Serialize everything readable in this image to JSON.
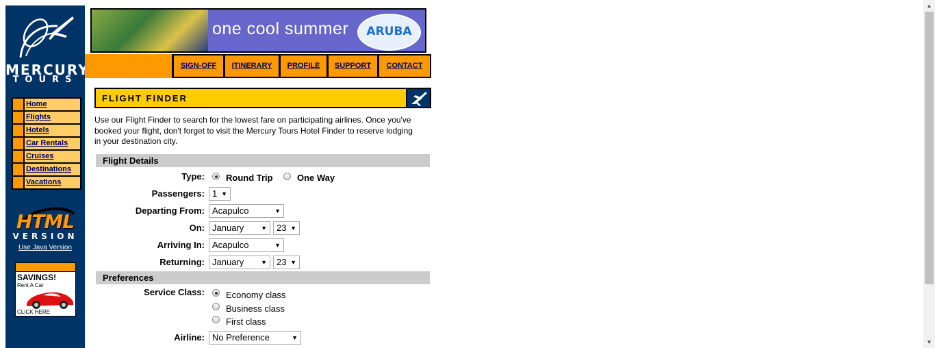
{
  "logo": {
    "line1": "MERCURY",
    "line2": "TOURS"
  },
  "sidebar": {
    "items": [
      {
        "label": "Home"
      },
      {
        "label": "Flights"
      },
      {
        "label": "Hotels"
      },
      {
        "label": "Car Rentals"
      },
      {
        "label": "Cruises"
      },
      {
        "label": "Destinations"
      },
      {
        "label": "Vacations"
      }
    ],
    "html_word": "HTML",
    "version_word": "VERSION",
    "java_link": "Use Java Version",
    "ad": {
      "savings": "SAVINGS!",
      "rent": "Rent A Car",
      "click": "CLICK HERE"
    }
  },
  "banner": {
    "text": "one cool summer",
    "brand": "ARUBA"
  },
  "topnav": [
    {
      "label": "SIGN-OFF"
    },
    {
      "label": "ITINERARY"
    },
    {
      "label": "PROFILE"
    },
    {
      "label": "SUPPORT"
    },
    {
      "label": "CONTACT"
    }
  ],
  "page": {
    "title": "FLIGHT FINDER",
    "intro": "Use our Flight Finder to search for the lowest fare on participating airlines. Once you've booked your flight, don't forget to visit the Mercury Tours Hotel Finder to reserve lodging in your destination city."
  },
  "flight_details": {
    "header": "Flight Details",
    "type_label": "Type:",
    "type_options": [
      {
        "label": "Round Trip",
        "selected": true
      },
      {
        "label": "One Way",
        "selected": false
      }
    ],
    "passengers_label": "Passengers:",
    "passengers_value": "1",
    "departing_label": "Departing From:",
    "departing_value": "Acapulco",
    "on_label": "On:",
    "on_month": "January",
    "on_day": "23",
    "arriving_label": "Arriving In:",
    "arriving_value": "Acapulco",
    "returning_label": "Returning:",
    "returning_month": "January",
    "returning_day": "23"
  },
  "preferences": {
    "header": "Preferences",
    "class_label": "Service Class:",
    "class_options": [
      {
        "label": "Economy class",
        "selected": true
      },
      {
        "label": "Business class",
        "selected": false
      },
      {
        "label": "First class",
        "selected": false
      }
    ],
    "airline_label": "Airline:",
    "airline_value": "No Preference"
  },
  "colors": {
    "navy": "#003366",
    "orange": "#ff9900",
    "yellow": "#ffcc00",
    "link": "#000066"
  }
}
